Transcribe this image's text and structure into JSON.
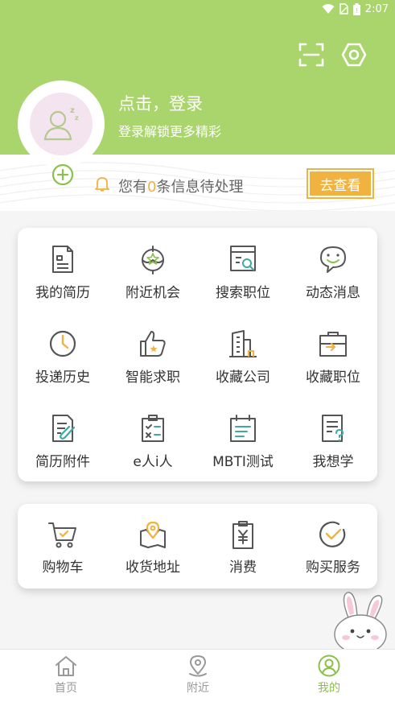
{
  "status_bar": {
    "time": "2:07"
  },
  "header": {
    "login_title": "点击，登录",
    "login_subtitle": "登录解锁更多精彩",
    "scan_icon": "scan-icon",
    "settings_icon": "settings-icon"
  },
  "notice": {
    "prefix": "您有",
    "count": "0",
    "suffix": "条信息待处理",
    "button": "去查看"
  },
  "grid_menu": [
    {
      "label": "我的简历",
      "icon": "resume-icon"
    },
    {
      "label": "附近机会",
      "icon": "nearby-icon"
    },
    {
      "label": "搜索职位",
      "icon": "search-job-icon"
    },
    {
      "label": "动态消息",
      "icon": "message-icon"
    },
    {
      "label": "投递历史",
      "icon": "clock-icon"
    },
    {
      "label": "智能求职",
      "icon": "thumbs-up-icon"
    },
    {
      "label": "收藏公司",
      "icon": "building-icon"
    },
    {
      "label": "收藏职位",
      "icon": "briefcase-icon"
    },
    {
      "label": "简历附件",
      "icon": "attachment-icon"
    },
    {
      "label": "e人i人",
      "icon": "checklist-icon"
    },
    {
      "label": "MBTI测试",
      "icon": "calendar-test-icon"
    },
    {
      "label": "我想学",
      "icon": "question-doc-icon"
    }
  ],
  "shop_menu": [
    {
      "label": "购物车",
      "icon": "cart-icon"
    },
    {
      "label": "收货地址",
      "icon": "map-pin-icon"
    },
    {
      "label": "消费",
      "icon": "yuan-receipt-icon"
    },
    {
      "label": "购买服务",
      "icon": "check-circle-icon"
    }
  ],
  "tabs": [
    {
      "label": "首页",
      "icon": "home-icon",
      "active": false
    },
    {
      "label": "附近",
      "icon": "location-icon",
      "active": false
    },
    {
      "label": "我的",
      "icon": "profile-icon",
      "active": true
    }
  ],
  "colors": {
    "brand_green": "#a9d56c",
    "accent_orange": "#f0b33f",
    "tab_active": "#8bc04a"
  }
}
